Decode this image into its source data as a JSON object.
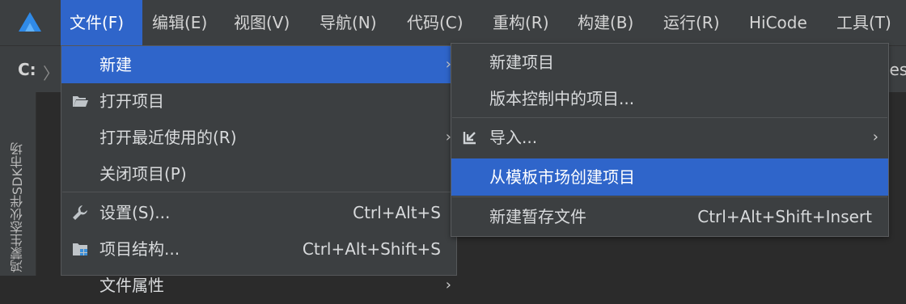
{
  "menubar": {
    "logo_icon": "deveco-logo-icon",
    "items": [
      {
        "label": "文件(F)"
      },
      {
        "label": "编辑(E)"
      },
      {
        "label": "视图(V)"
      },
      {
        "label": "导航(N)"
      },
      {
        "label": "代码(C)"
      },
      {
        "label": "重构(R)"
      },
      {
        "label": "构建(B)"
      },
      {
        "label": "运行(R)"
      },
      {
        "label": "HiCode"
      },
      {
        "label": "工具(T)"
      }
    ]
  },
  "navbar": {
    "drive": "C:",
    "separator": "〉",
    "partial_text": "ies"
  },
  "left_panel": {
    "vertical_label": "鸿蒙生态伙伴SDK市场"
  },
  "file_menu": {
    "items": [
      {
        "label": "新建",
        "icon": "",
        "shortcut": "",
        "arrow": "›"
      },
      {
        "label": "打开项目",
        "icon": "folder-open-icon",
        "shortcut": "",
        "arrow": ""
      },
      {
        "label": "打开最近使用的(R)",
        "icon": "",
        "shortcut": "",
        "arrow": "›"
      },
      {
        "label": "关闭项目(P)",
        "icon": "",
        "shortcut": "",
        "arrow": ""
      },
      {
        "label": "设置(S)...",
        "icon": "wrench-icon",
        "shortcut": "Ctrl+Alt+S",
        "arrow": ""
      },
      {
        "label": "项目结构...",
        "icon": "project-structure-icon",
        "shortcut": "Ctrl+Alt+Shift+S",
        "arrow": ""
      },
      {
        "label": "文件属性",
        "icon": "",
        "shortcut": "",
        "arrow": "›"
      }
    ]
  },
  "new_submenu": {
    "items": [
      {
        "label": "新建项目",
        "icon": "",
        "shortcut": "",
        "arrow": ""
      },
      {
        "label": "版本控制中的项目...",
        "icon": "",
        "shortcut": "",
        "arrow": ""
      },
      {
        "label": "导入...",
        "icon": "import-icon",
        "shortcut": "",
        "arrow": "›"
      },
      {
        "label": "从模板市场创建项目",
        "icon": "",
        "shortcut": "",
        "arrow": ""
      },
      {
        "label": "新建暂存文件",
        "icon": "",
        "shortcut": "Ctrl+Alt+Shift+Insert",
        "arrow": ""
      }
    ]
  },
  "colors": {
    "accent": "#2f65ca",
    "menu_bg": "#3c3f41",
    "editor_bg": "#2b2b2b",
    "text": "#d8dadc"
  }
}
